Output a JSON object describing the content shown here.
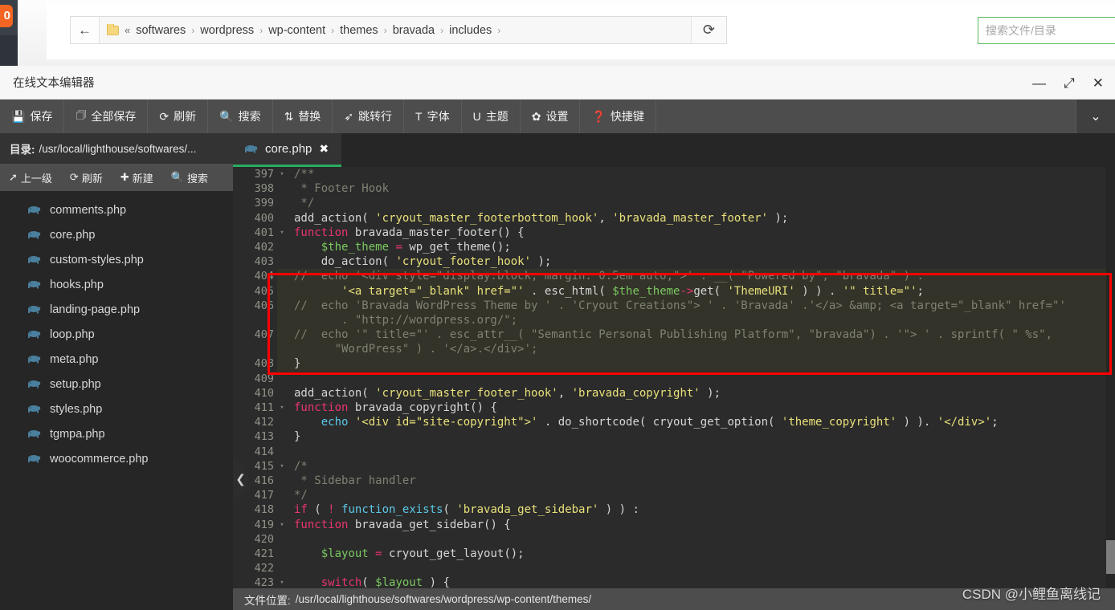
{
  "browser": {
    "back_icon": "←",
    "double_chevron": "«",
    "breadcrumbs": [
      "softwares",
      "wordpress",
      "wp-content",
      "themes",
      "bravada",
      "includes"
    ],
    "crumb_separator": "›",
    "reload_icon": "⟳",
    "search_placeholder": "搜索文件/目录",
    "badge_text": "0"
  },
  "window": {
    "title": "在线文本编辑器",
    "minimize": "—",
    "maximize": "⤢",
    "close": "✕"
  },
  "toolbar": {
    "items": [
      {
        "label": "保存",
        "icon": "save-icon",
        "glyph": "💾"
      },
      {
        "label": "全部保存",
        "icon": "save-all-icon",
        "glyph": "🗇"
      },
      {
        "label": "刷新",
        "icon": "refresh-icon",
        "glyph": "⟳"
      },
      {
        "label": "搜索",
        "icon": "search-icon",
        "glyph": "🔍"
      },
      {
        "label": "替换",
        "icon": "replace-icon",
        "glyph": "⇅"
      },
      {
        "label": "跳转行",
        "icon": "goto-line-icon",
        "glyph": "➶"
      },
      {
        "label": "字体",
        "icon": "font-icon",
        "glyph": "T"
      },
      {
        "label": "主题",
        "icon": "theme-icon",
        "glyph": "U"
      },
      {
        "label": "设置",
        "icon": "settings-icon",
        "glyph": "✿"
      },
      {
        "label": "快捷键",
        "icon": "shortcut-icon",
        "glyph": "❓"
      }
    ],
    "caret": "⌄"
  },
  "sidebar": {
    "path_label": "目录:",
    "path_value": "/usr/local/lighthouse/softwares/...",
    "tools": [
      {
        "label": "上一级",
        "icon": "up-level-icon",
        "glyph": "➚"
      },
      {
        "label": "刷新",
        "icon": "refresh-icon",
        "glyph": "⟳"
      },
      {
        "label": "新建",
        "icon": "new-file-icon",
        "glyph": "✚"
      },
      {
        "label": "搜索",
        "icon": "search-icon",
        "glyph": "🔍"
      }
    ],
    "files": [
      "comments.php",
      "core.php",
      "custom-styles.php",
      "hooks.php",
      "landing-page.php",
      "loop.php",
      "meta.php",
      "setup.php",
      "styles.php",
      "tgmpa.php",
      "woocommerce.php"
    ],
    "collapse_icon": "❮"
  },
  "tabs": [
    {
      "label": "core.php",
      "icon": "php-elephant-icon",
      "close": "✖",
      "active": true
    }
  ],
  "editor": {
    "first_visible_line": 397,
    "lines": [
      {
        "n": 397,
        "fold": true,
        "hl": false,
        "tokens": [
          {
            "t": "/**",
            "c": "c-cmt"
          }
        ]
      },
      {
        "n": 398,
        "fold": false,
        "hl": false,
        "tokens": [
          {
            "t": " * Footer Hook",
            "c": "c-cmt"
          }
        ]
      },
      {
        "n": 399,
        "fold": false,
        "hl": false,
        "tokens": [
          {
            "t": " */",
            "c": "c-cmt"
          }
        ]
      },
      {
        "n": 400,
        "fold": false,
        "hl": false,
        "tokens": [
          {
            "t": "add_action",
            "c": "c-plain"
          },
          {
            "t": "( ",
            "c": "c-plain"
          },
          {
            "t": "'cryout_master_footerbottom_hook'",
            "c": "c-str"
          },
          {
            "t": ", ",
            "c": "c-plain"
          },
          {
            "t": "'bravada_master_footer'",
            "c": "c-str"
          },
          {
            "t": " );",
            "c": "c-plain"
          }
        ]
      },
      {
        "n": 401,
        "fold": true,
        "hl": false,
        "tokens": [
          {
            "t": "function",
            "c": "c-kw"
          },
          {
            "t": " bravada_master_footer() {",
            "c": "c-plain"
          }
        ]
      },
      {
        "n": 402,
        "fold": false,
        "hl": false,
        "tokens": [
          {
            "t": "    ",
            "c": "c-plain"
          },
          {
            "t": "$the_theme",
            "c": "c-var"
          },
          {
            "t": " = ",
            "c": "c-op"
          },
          {
            "t": "wp_get_theme();",
            "c": "c-plain"
          }
        ]
      },
      {
        "n": 403,
        "fold": false,
        "hl": false,
        "tokens": [
          {
            "t": "    do_action( ",
            "c": "c-plain"
          },
          {
            "t": "'cryout_footer_hook'",
            "c": "c-str"
          },
          {
            "t": " );",
            "c": "c-plain"
          }
        ]
      },
      {
        "n": 404,
        "fold": false,
        "hl": true,
        "tokens": [
          {
            "t": "//  echo '<div style=\"display:block; margin: 0.5em auto;\">' . __( \"Powered by\", \"bravada\" ) .",
            "c": "c-cmt"
          }
        ]
      },
      {
        "n": 405,
        "fold": false,
        "hl": true,
        "tokens": [
          {
            "t": "       ",
            "c": "c-plain"
          },
          {
            "t": "'<a target=\"_blank\" href=\"'",
            "c": "c-str"
          },
          {
            "t": " . ",
            "c": "c-plain"
          },
          {
            "t": "esc_html",
            "c": "c-plain"
          },
          {
            "t": "( ",
            "c": "c-plain"
          },
          {
            "t": "$the_theme",
            "c": "c-var"
          },
          {
            "t": "->",
            "c": "c-op"
          },
          {
            "t": "get( ",
            "c": "c-plain"
          },
          {
            "t": "'ThemeURI'",
            "c": "c-str"
          },
          {
            "t": " ) ) . ",
            "c": "c-plain"
          },
          {
            "t": "'\" title=\"'",
            "c": "c-str"
          },
          {
            "t": ";",
            "c": "c-plain"
          }
        ]
      },
      {
        "n": 406,
        "fold": false,
        "hl": true,
        "tokens": [
          {
            "t": "//  echo 'Bravada WordPress Theme by ' . 'Cryout Creations\"> ' . 'Bravada' .'</a> &amp; <a target=\"_blank\" href=\"'",
            "c": "c-cmt"
          }
        ]
      },
      {
        "n": null,
        "fold": false,
        "hl": true,
        "tokens": [
          {
            "t": "       . \"http://wordpress.org/\";",
            "c": "c-cmt"
          }
        ]
      },
      {
        "n": 407,
        "fold": false,
        "hl": true,
        "tokens": [
          {
            "t": "//  echo '\" title=\"' . esc_attr__( \"Semantic Personal Publishing Platform\", \"bravada\") . '\"> ' . sprintf( \" %s\",",
            "c": "c-cmt"
          }
        ]
      },
      {
        "n": null,
        "fold": false,
        "hl": true,
        "tokens": [
          {
            "t": "      \"WordPress\" ) . '</a>.</div>';",
            "c": "c-cmt"
          }
        ]
      },
      {
        "n": 408,
        "fold": false,
        "hl": true,
        "tokens": [
          {
            "t": "}",
            "c": "c-plain"
          }
        ]
      },
      {
        "n": 409,
        "fold": false,
        "hl": false,
        "tokens": [
          {
            "t": "",
            "c": "c-plain"
          }
        ]
      },
      {
        "n": 410,
        "fold": false,
        "hl": false,
        "tokens": [
          {
            "t": "add_action( ",
            "c": "c-plain"
          },
          {
            "t": "'cryout_master_footer_hook'",
            "c": "c-str"
          },
          {
            "t": ", ",
            "c": "c-plain"
          },
          {
            "t": "'bravada_copyright'",
            "c": "c-str"
          },
          {
            "t": " );",
            "c": "c-plain"
          }
        ]
      },
      {
        "n": 411,
        "fold": true,
        "hl": false,
        "tokens": [
          {
            "t": "function",
            "c": "c-kw"
          },
          {
            "t": " bravada_copyright() {",
            "c": "c-plain"
          }
        ]
      },
      {
        "n": 412,
        "fold": false,
        "hl": false,
        "tokens": [
          {
            "t": "    ",
            "c": "c-plain"
          },
          {
            "t": "echo",
            "c": "c-blue"
          },
          {
            "t": " ",
            "c": "c-plain"
          },
          {
            "t": "'<div id=\"site-copyright\">'",
            "c": "c-str"
          },
          {
            "t": " . do_shortcode( cryout_get_option( ",
            "c": "c-plain"
          },
          {
            "t": "'theme_copyright'",
            "c": "c-str"
          },
          {
            "t": " ) ). ",
            "c": "c-plain"
          },
          {
            "t": "'</div>'",
            "c": "c-str"
          },
          {
            "t": ";",
            "c": "c-plain"
          }
        ]
      },
      {
        "n": 413,
        "fold": false,
        "hl": false,
        "tokens": [
          {
            "t": "}",
            "c": "c-plain"
          }
        ]
      },
      {
        "n": 414,
        "fold": false,
        "hl": false,
        "tokens": [
          {
            "t": "",
            "c": "c-plain"
          }
        ]
      },
      {
        "n": 415,
        "fold": true,
        "hl": false,
        "tokens": [
          {
            "t": "/*",
            "c": "c-cmt"
          }
        ]
      },
      {
        "n": 416,
        "fold": false,
        "hl": false,
        "tokens": [
          {
            "t": " * Sidebar handler",
            "c": "c-cmt"
          }
        ]
      },
      {
        "n": 417,
        "fold": false,
        "hl": false,
        "tokens": [
          {
            "t": "*/",
            "c": "c-cmt"
          }
        ]
      },
      {
        "n": 418,
        "fold": false,
        "hl": false,
        "tokens": [
          {
            "t": "if",
            "c": "c-kw"
          },
          {
            "t": " ( ",
            "c": "c-plain"
          },
          {
            "t": "!",
            "c": "c-op"
          },
          {
            "t": " ",
            "c": "c-plain"
          },
          {
            "t": "function_exists",
            "c": "c-blue"
          },
          {
            "t": "( ",
            "c": "c-plain"
          },
          {
            "t": "'bravada_get_sidebar'",
            "c": "c-str"
          },
          {
            "t": " ) ) :",
            "c": "c-plain"
          }
        ]
      },
      {
        "n": 419,
        "fold": true,
        "hl": false,
        "tokens": [
          {
            "t": "function",
            "c": "c-kw"
          },
          {
            "t": " bravada_get_sidebar() {",
            "c": "c-plain"
          }
        ]
      },
      {
        "n": 420,
        "fold": false,
        "hl": false,
        "tokens": [
          {
            "t": "",
            "c": "c-plain"
          }
        ]
      },
      {
        "n": 421,
        "fold": false,
        "hl": false,
        "tokens": [
          {
            "t": "    ",
            "c": "c-plain"
          },
          {
            "t": "$layout",
            "c": "c-var"
          },
          {
            "t": " = ",
            "c": "c-op"
          },
          {
            "t": "cryout_get_layout();",
            "c": "c-plain"
          }
        ]
      },
      {
        "n": 422,
        "fold": false,
        "hl": false,
        "tokens": [
          {
            "t": "",
            "c": "c-plain"
          }
        ]
      },
      {
        "n": 423,
        "fold": true,
        "hl": false,
        "tokens": [
          {
            "t": "    ",
            "c": "c-plain"
          },
          {
            "t": "switch",
            "c": "c-kw"
          },
          {
            "t": "( ",
            "c": "c-plain"
          },
          {
            "t": "$layout",
            "c": "c-var"
          },
          {
            "t": " ) {",
            "c": "c-plain"
          }
        ]
      }
    ]
  },
  "statusbar": {
    "label": "文件位置:",
    "value": "/usr/local/lighthouse/softwares/wordpress/wp-content/themes/"
  },
  "watermark": "CSDN @小鲤鱼离线记",
  "colors": {
    "accent_green": "#27ae60",
    "annotation_red": "#ff0000",
    "toolbar_bg": "#4d4d4d",
    "editor_bg": "#2b2b2b",
    "sidebar_bg": "#262626",
    "badge_orange": "#f26522"
  }
}
